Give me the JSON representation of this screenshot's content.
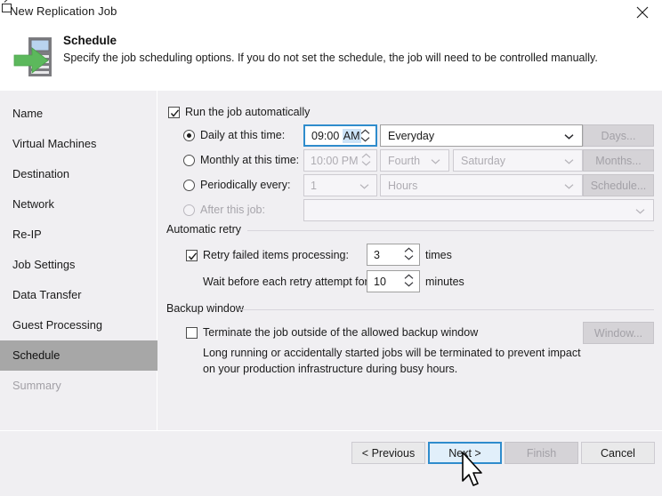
{
  "window": {
    "title": "New Replication Job",
    "close_icon": "close-icon"
  },
  "header": {
    "icon": "replication-server-arrow-icon",
    "title": "Schedule",
    "subtitle": "Specify the job scheduling options. If you do not set the schedule, the job will need to be controlled manually."
  },
  "sidebar": {
    "items": [
      {
        "label": "Name",
        "state": "normal"
      },
      {
        "label": "Virtual Machines",
        "state": "normal"
      },
      {
        "label": "Destination",
        "state": "normal"
      },
      {
        "label": "Network",
        "state": "normal"
      },
      {
        "label": "Re-IP",
        "state": "normal"
      },
      {
        "label": "Job Settings",
        "state": "normal"
      },
      {
        "label": "Data Transfer",
        "state": "normal"
      },
      {
        "label": "Guest Processing",
        "state": "normal"
      },
      {
        "label": "Schedule",
        "state": "selected"
      },
      {
        "label": "Summary",
        "state": "disabled"
      }
    ]
  },
  "schedule": {
    "run_automatically": {
      "label": "Run the job automatically",
      "checked": true
    },
    "daily": {
      "label": "Daily at this time:",
      "selected": true,
      "time_value": "09:00",
      "time_meridiem": "AM",
      "day_dropdown": "Everyday",
      "button": "Days..."
    },
    "monthly": {
      "label": "Monthly at this time:",
      "selected": false,
      "time_value": "10:00 PM",
      "ordinal_dropdown": "Fourth",
      "weekday_dropdown": "Saturday",
      "button": "Months..."
    },
    "periodically": {
      "label": "Periodically every:",
      "selected": false,
      "count_dropdown": "1",
      "unit_dropdown": "Hours",
      "button": "Schedule..."
    },
    "after_job": {
      "label": "After this job:",
      "selected": false,
      "dropdown": ""
    }
  },
  "automatic_retry": {
    "group_title": "Automatic retry",
    "retry_checkbox": {
      "label": "Retry failed items processing:",
      "checked": true
    },
    "retry_count": "3",
    "retry_count_unit": "times",
    "wait_label": "Wait before each retry attempt for:",
    "wait_value": "10",
    "wait_unit": "minutes"
  },
  "backup_window": {
    "group_title": "Backup window",
    "terminate_checkbox": {
      "label": "Terminate the job outside of the allowed backup window",
      "checked": false
    },
    "description_line1": "Long running or accidentally started jobs will be terminated to prevent impact",
    "description_line2": "on your production infrastructure during busy hours.",
    "button": "Window..."
  },
  "footer": {
    "previous": "< Previous",
    "next": "Next >",
    "finish": "Finish",
    "cancel": "Cancel"
  }
}
